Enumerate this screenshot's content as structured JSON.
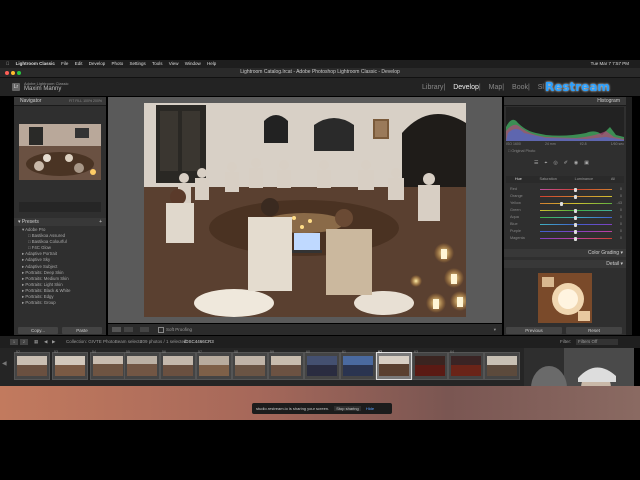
{
  "menubar": {
    "apple": "",
    "items": [
      "Lightroom Classic",
      "File",
      "Edit",
      "Develop",
      "Photo",
      "Settings",
      "Tools",
      "View",
      "Window",
      "Help"
    ],
    "clock": "Tue Mar 7  7:57 PM"
  },
  "window": {
    "title": "Lightroom Catalog.lrcat - Adobe Photoshop Lightroom Classic - Develop"
  },
  "identity": {
    "app": "Adobe Lightroom Classic",
    "user": "Maxim Manny",
    "modules": [
      "Library",
      "Develop",
      "Map",
      "Book",
      "Sl"
    ],
    "active_module": "Develop"
  },
  "overlay": {
    "brand": "Restream"
  },
  "left_panel": {
    "navigator_label": "Navigator",
    "navigator_zoom": [
      "FIT",
      "FILL",
      "100%",
      "200%"
    ],
    "presets_label": "Presets",
    "presets": [
      "Adobe Pro",
      "Bastikoa Assured",
      "Bastikoa Colourful",
      "F4C Glow",
      "Adaptive Portrait",
      "Adaptive Sky",
      "Adaptive Subject",
      "Portraits: Deep Skin",
      "Portraits: Medium Skin",
      "Portraits: Light Skin",
      "Portraits: Black & White",
      "Portraits: Edgy",
      "Portraits: Group"
    ],
    "copy_label": "Copy...",
    "paste_label": "Paste"
  },
  "right_panel": {
    "histogram_label": "Histogram",
    "histogram_stats": [
      "ISO 1600",
      "24 mm",
      "f/2.8",
      "1/60 sec"
    ],
    "original_photo_label": "Original Photo",
    "hsl_tabs": [
      "Hue",
      "Saturation",
      "Luminance",
      "All"
    ],
    "hsl_rows": [
      {
        "label": "Red",
        "value": "0"
      },
      {
        "label": "Orange",
        "value": "0"
      },
      {
        "label": "Yellow",
        "value": "-43"
      },
      {
        "label": "Green",
        "value": "0"
      },
      {
        "label": "Aqua",
        "value": "0"
      },
      {
        "label": "Blue",
        "value": "0"
      },
      {
        "label": "Purple",
        "value": "0"
      },
      {
        "label": "Magenta",
        "value": "0"
      }
    ],
    "color_grading_label": "Color Grading",
    "detail_label": "Detail",
    "previous_label": "Previous",
    "reset_label": "Reset"
  },
  "center_toolbar": {
    "soft_proofing_label": "Soft Proofing"
  },
  "filmstrip_bar": {
    "pages": [
      "1",
      "2"
    ],
    "collection": "Collection: GIVTE PhotoBeam selects",
    "count": "209 photos / 1 selected",
    "file": "/DSC4466CR3",
    "filter_label": "Filter:",
    "filter_value": "Filters Off"
  },
  "filmstrip": {
    "thumb_numbers": [
      "52",
      "53",
      "54",
      "55",
      "56",
      "57",
      "58",
      "59",
      "60",
      "61",
      "62",
      "63",
      "64"
    ],
    "selected_index": 10
  },
  "sharing": {
    "message": "studio.restream.io is sharing your screen.",
    "stop_label": "Stop sharing",
    "hide_label": "Hide"
  }
}
